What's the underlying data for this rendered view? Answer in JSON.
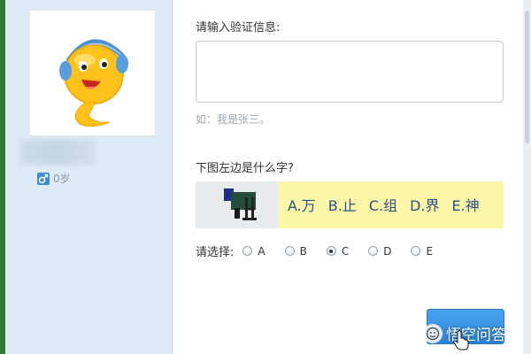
{
  "profile": {
    "age_text": "0岁",
    "gender_icon": "male-icon",
    "avatar_icon": "smiley-headphones-icon"
  },
  "form": {
    "verify_label": "请输入验证信息:",
    "verify_value": "",
    "example_hint": "如：我是张三。",
    "question": "下图左边是什么字?",
    "options": [
      "A.万",
      "B.止",
      "C.组",
      "D.界",
      "E.神"
    ],
    "choose_label": "请选择:",
    "radios": [
      {
        "label": "A",
        "checked": false
      },
      {
        "label": "B",
        "checked": false
      },
      {
        "label": "C",
        "checked": true
      },
      {
        "label": "D",
        "checked": false
      },
      {
        "label": "E",
        "checked": false
      }
    ],
    "submit_label": ""
  },
  "watermark": {
    "text": "悟空问答",
    "icon": "wukong-icon"
  },
  "colors": {
    "accent": "#2c84d8",
    "captcha_bg": "#fcf7a7",
    "left_panel": "#deebf6",
    "option_text": "#2a4f8a"
  }
}
